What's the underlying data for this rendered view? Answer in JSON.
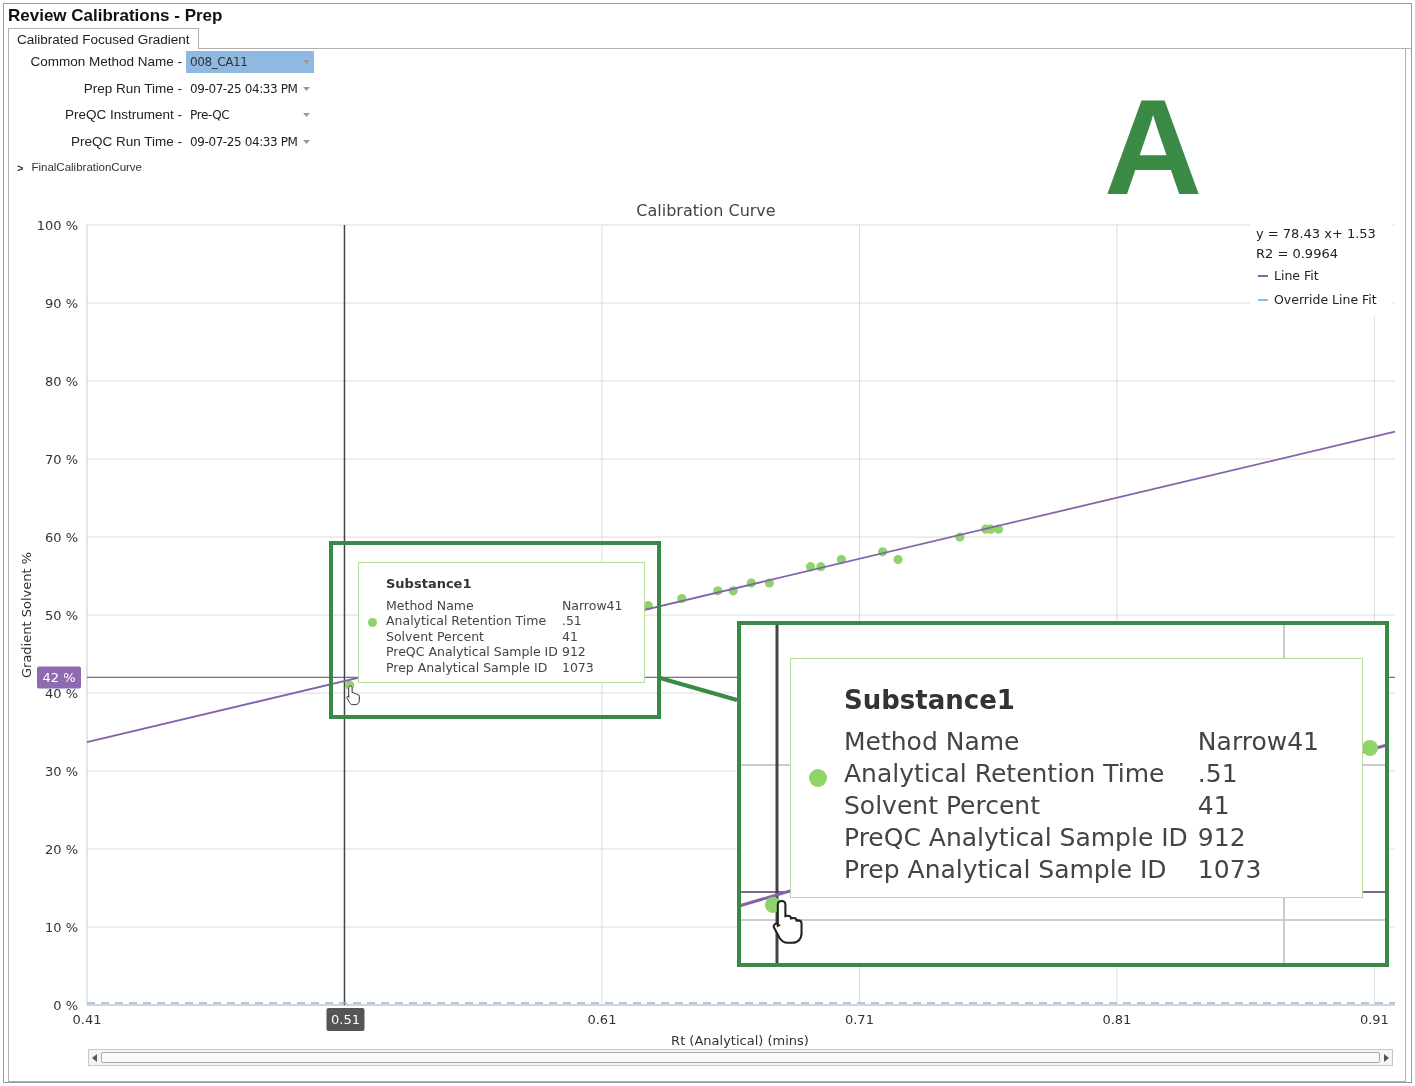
{
  "window": {
    "title": "Review Calibrations - Prep"
  },
  "tabs": [
    {
      "label": "Calibrated Focused Gradient",
      "selected": true
    }
  ],
  "filters": [
    {
      "label": "Common Method Name -",
      "value": "008_CA11",
      "focused": true
    },
    {
      "label": "Prep Run Time -",
      "value": "09-07-25 04:33 PM",
      "focused": false
    },
    {
      "label": "PreQC Instrument -",
      "value": "Pre-QC",
      "focused": false
    },
    {
      "label": "PreQC Run Time -",
      "value": "09-07-25 04:33 PM",
      "focused": false
    }
  ],
  "tree_item": {
    "toggle": ">",
    "label": "FinalCalibrationCurve",
    "expanded": false
  },
  "annotation": {
    "letter": "A"
  },
  "chart": {
    "chart_data": {
      "type": "scatter",
      "title": "Calibration Curve",
      "xlabel": "Rt (Analytical) (mins)",
      "ylabel": "Gradient Solvent %",
      "xlim": [
        0.41,
        0.918
      ],
      "ylim": [
        0,
        100
      ],
      "xticks": [
        0.41,
        0.61,
        0.71,
        0.81,
        0.91
      ],
      "yticks": [
        {
          "value": 0,
          "label": "0 %"
        },
        {
          "value": 10,
          "label": "10 %"
        },
        {
          "value": 20,
          "label": "20 %"
        },
        {
          "value": 30,
          "label": "30 %"
        },
        {
          "value": 40,
          "label": "40 %"
        },
        {
          "value": 50,
          "label": "50 %"
        },
        {
          "value": 60,
          "label": "60 %"
        },
        {
          "value": 70,
          "label": "70 %"
        },
        {
          "value": 80,
          "label": "80 %"
        },
        {
          "value": 90,
          "label": "90 %"
        },
        {
          "value": 100,
          "label": "100 %"
        }
      ],
      "series": [
        {
          "color": "#8fd46a",
          "x": [
            0.512,
            0.628,
            0.641,
            0.655,
            0.661,
            0.668,
            0.675,
            0.691,
            0.695,
            0.703,
            0.719,
            0.725,
            0.749,
            0.759,
            0.761,
            0.764
          ],
          "values": [
            41,
            51.2,
            52.1,
            53.1,
            53.1,
            54.1,
            54.1,
            56.2,
            56.2,
            57.1,
            58.1,
            57.1,
            60,
            61,
            61,
            61
          ]
        },
        {
          "type": "line",
          "name": "Line Fit",
          "color": "#8463ab",
          "x": [
            0.41,
            0.918
          ],
          "values": [
            33.7,
            73.5
          ]
        },
        {
          "type": "line",
          "line_style": "dashed",
          "name": "Override Line Fit",
          "color": "#8cbbe8",
          "x": [
            0.41,
            0.918
          ],
          "values": [
            0,
            0
          ]
        }
      ],
      "annotations": [
        {
          "text": "y = 78.43 x+ 1.53"
        },
        {
          "text": "R2 = 0.9964"
        }
      ],
      "ref_lines": [
        {
          "axis": "y",
          "value": 42,
          "label": "42 %",
          "color": "#7a6a90"
        },
        {
          "axis": "x",
          "value": 0.51,
          "label": "0.51",
          "color": "#444444"
        }
      ],
      "grid": true,
      "legend": "upper right"
    }
  },
  "tooltip": {
    "title": "Substance1",
    "rows": [
      {
        "label": "Method Name",
        "value": "Narrow41"
      },
      {
        "label": "Analytical Retention Time",
        "value": ".51"
      },
      {
        "label": "Solvent Percent",
        "value": "41"
      },
      {
        "label": "PreQC Analytical Sample ID",
        "value": "912"
      },
      {
        "label": "Prep Analytical Sample ID",
        "value": "1073"
      }
    ]
  },
  "zoom_callout": {
    "title": "Substance1",
    "rows": [
      {
        "label": "Method Name",
        "value": "Narrow41"
      },
      {
        "label": "Analytical Retention Time",
        "value": ".51"
      },
      {
        "label": "Solvent Percent",
        "value": "41"
      },
      {
        "label": "PreQC Analytical Sample ID",
        "value": "912"
      },
      {
        "label": "Prep Analytical Sample ID",
        "value": "1073"
      }
    ]
  }
}
